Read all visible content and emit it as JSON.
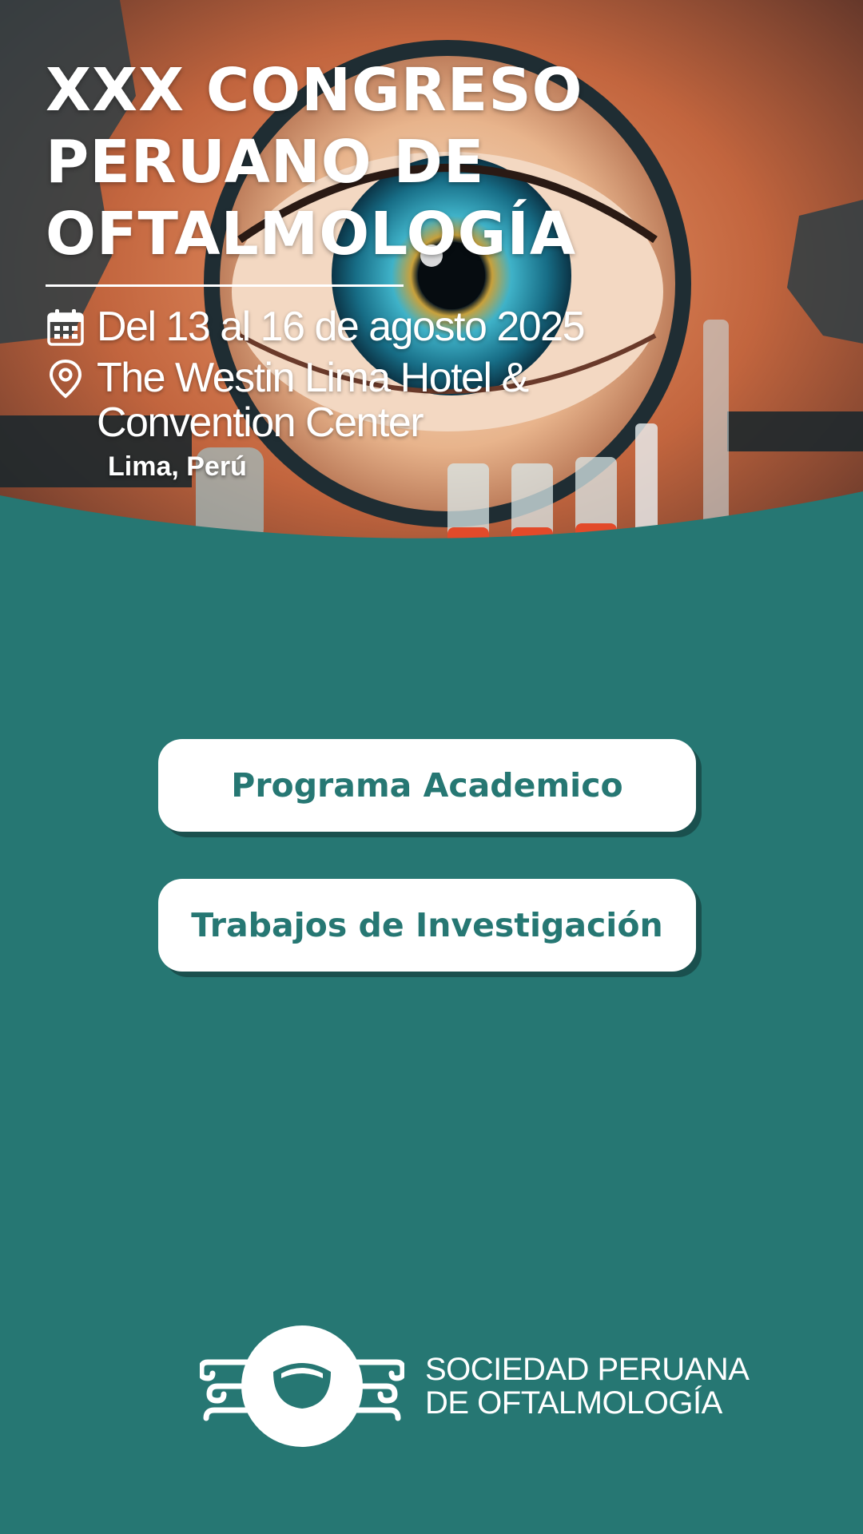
{
  "event": {
    "title": "XXX CONGRESO PERUANO DE OFTALMOLOGÍA",
    "dates": "Del 13 al 16 de agosto 2025",
    "venue": "The Westin Lima Hotel & Convention Center",
    "city": "Lima, Perú"
  },
  "actions": {
    "program_label": "Programa Academico",
    "research_label": "Trabajos de Investigación"
  },
  "organizer": {
    "line1": "SOCIEDAD PERUANA",
    "line2": "DE OFTALMOLOGÍA"
  },
  "icons": {
    "calendar": "calendar-icon",
    "location": "location-pin-icon",
    "logo": "spo-logo-mark"
  },
  "colors": {
    "primary": "#267773",
    "button_bg": "#ffffff",
    "text_light": "#ffffff"
  }
}
